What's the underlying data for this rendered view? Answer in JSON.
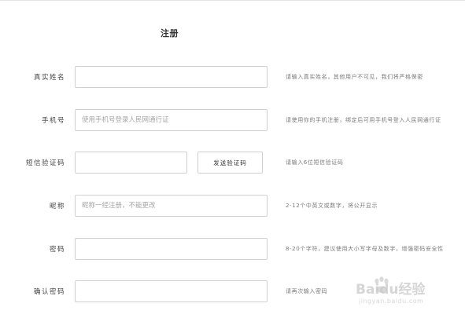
{
  "form": {
    "title": "注册",
    "real_name": {
      "label": "真实姓名",
      "placeholder": "",
      "hint": "请输入真实姓名，其他用户不可见，我们将严格保密"
    },
    "phone": {
      "label": "手机号",
      "placeholder": "使用手机号登录人民网通行证",
      "hint": "请使用你的手机注册，绑定后可用手机号登入人民网通行证"
    },
    "sms_code": {
      "label": "短信验证码",
      "placeholder": "",
      "button_label": "发送验证码",
      "hint": "请输入6位短信验证码"
    },
    "nickname": {
      "label": "昵称",
      "placeholder": "昵称一经注册，不能更改",
      "hint": "2-12个中英文或数字，将公开显示"
    },
    "password": {
      "label": "密码",
      "placeholder": "",
      "hint": "8-20个字符，建议使用大小写字母及数字，增强密码安全性"
    },
    "confirm_password": {
      "label": "确认密码",
      "placeholder": "",
      "hint": "请再次输入密码"
    }
  },
  "watermark": {
    "brand": "Baidu经验",
    "url": "jingyan.baidu.com"
  }
}
